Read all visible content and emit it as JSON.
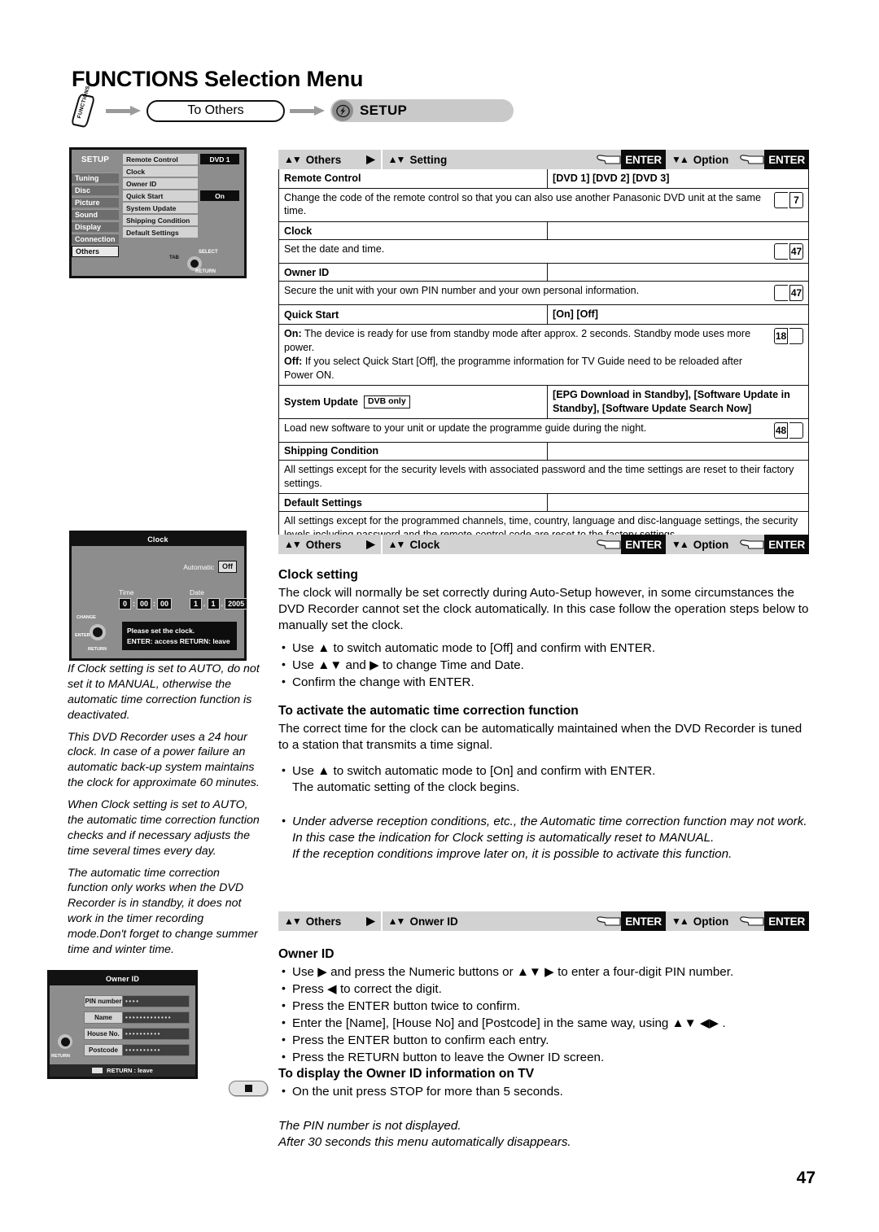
{
  "page": {
    "title": "FUNCTIONS Selection Menu",
    "folio": "47"
  },
  "flow": {
    "functions_button": "FUNCTIONS",
    "to_others": "To Others",
    "setup": "SETUP",
    "setup_icon": "lightning-bolt-icon"
  },
  "setup_screen": {
    "title": "SETUP",
    "categories": [
      "Tuning",
      "Disc",
      "Picture",
      "Sound",
      "Display",
      "Connection",
      "Others"
    ],
    "selected_category": "Others",
    "items": [
      {
        "name": "Remote Control",
        "value": "DVD 1"
      },
      {
        "name": "Clock",
        "value": ""
      },
      {
        "name": "Owner ID",
        "value": ""
      },
      {
        "name": "Quick Start",
        "value": "On"
      },
      {
        "name": "System Update",
        "value": ""
      },
      {
        "name": "Shipping Condition",
        "value": ""
      },
      {
        "name": "Default Settings",
        "value": ""
      }
    ],
    "hint_tab": "TAB",
    "hint_select": "SELECT",
    "hint_return": "RETURN"
  },
  "clock_screen": {
    "title": "Clock",
    "automatic_label": "Automatic",
    "automatic_value": "Off",
    "time_label": "Time",
    "date_label": "Date",
    "time_fields": [
      "0",
      "00",
      "00"
    ],
    "date_fields": [
      "1",
      "1",
      "2005"
    ],
    "message_line1": "Please set the clock.",
    "message_line2": "ENTER: access   RETURN: leave",
    "dpad_change": "CHANGE",
    "dpad_enter": "ENTER",
    "dpad_return": "RETURN"
  },
  "owner_screen": {
    "title": "Owner ID",
    "fields": [
      {
        "label": "PIN number",
        "value": "••••"
      },
      {
        "label": "Name",
        "value": "•••••••••••••"
      },
      {
        "label": "House No.",
        "value": "••••••••••"
      },
      {
        "label": "Postcode",
        "value": "••••••••••"
      }
    ],
    "dpad_return": "RETURN",
    "footer": "RETURN : leave"
  },
  "bar_setting": {
    "nav1_arrows": "▲▼",
    "nav1_label": "Others",
    "nav_right_arrow": "▶",
    "nav2_arrows": "▲▼",
    "nav2_label": "Setting",
    "enter1": "ENTER",
    "opt_arrows": "▼▲",
    "opt_label": "Option",
    "enter2": "ENTER"
  },
  "bar_clock": {
    "nav1_arrows": "▲▼",
    "nav1_label": "Others",
    "nav_right_arrow": "▶",
    "nav2_arrows": "▲▼",
    "nav2_label": "Clock",
    "enter1": "ENTER",
    "opt_arrows": "▼▲",
    "opt_label": "Option",
    "enter2": "ENTER"
  },
  "bar_owner": {
    "nav1_arrows": "▲▼",
    "nav1_label": "Others",
    "nav_right_arrow": "▶",
    "nav2_arrows": "▲▼",
    "nav2_label": "Onwer ID",
    "enter1": "ENTER",
    "opt_arrows": "▼▲",
    "opt_label": "Option",
    "enter2": "ENTER"
  },
  "spec_table": [
    {
      "name": "Remote Control",
      "options": "[DVD 1]  [DVD 2]  [DVD 3]",
      "desc": "Change the code of the remote control so that you can also use another Panasonic DVD unit at the same time.",
      "page_ref": "7",
      "page_ref_side": "right",
      "badge": ""
    },
    {
      "name": "Clock",
      "options": "",
      "desc": "Set the date and time.",
      "page_ref": "47",
      "page_ref_side": "right",
      "badge": ""
    },
    {
      "name": "Owner ID",
      "options": "",
      "desc": "Secure the unit with your own PIN number and your own personal information.",
      "page_ref": "47",
      "page_ref_side": "right",
      "badge": ""
    },
    {
      "name": "Quick Start",
      "options": "[On]  [Off]",
      "desc": "",
      "desc_rich": [
        {
          "bold": "On:",
          "text": " The device is ready for use from standby mode after approx. 2 seconds. Standby mode uses more power."
        },
        {
          "bold": "Off:",
          "text": " If you select Quick Start [Off], the programme information for TV Guide need to be reloaded after Power ON."
        }
      ],
      "page_ref": "18",
      "page_ref_side": "left",
      "badge": ""
    },
    {
      "name": "System Update",
      "badge": "DVB only",
      "options": "[EPG Download in Standby], [Software Update in Standby], [Software Update Search Now]",
      "desc": "Load new software to your unit or update the programme guide during the night.",
      "page_ref": "48",
      "page_ref_side": "left"
    },
    {
      "name": "Shipping Condition",
      "options": "",
      "desc": "All settings except for the security levels with associated password and the time settings are reset to their factory settings.",
      "page_ref": "",
      "page_ref_side": "",
      "badge": ""
    },
    {
      "name": "Default Settings",
      "options": "",
      "desc": "All settings except for the programmed channels, time, country, language and disc-language settings, the security levels including password and the remote-control code are reset to the factory settings.",
      "page_ref": "",
      "page_ref_side": "",
      "badge": ""
    }
  ],
  "clock_section": {
    "heading": "Clock setting",
    "intro": "The clock will normally be set correctly during Auto-Setup however, in some circumstances the DVD Recorder cannot set the clock automatically. In this case follow the operation steps below to manually set the clock.",
    "bullets": [
      "Use ▲ to switch automatic mode to [Off] and confirm with ENTER.",
      "Use ▲▼ and ▶ to change Time and Date.",
      "Confirm the change with ENTER."
    ],
    "sub_heading": "To activate the automatic time correction function",
    "sub_intro": "The correct time for the clock can be automatically maintained when the DVD Recorder is tuned to a station that transmits a time signal.",
    "bullet_on_1": "Use ▲ to switch automatic mode to [On] and confirm with ENTER.",
    "bullet_on_2": "The automatic setting of the clock begins.",
    "bullet_italic_1": "Under adverse reception conditions, etc., the Automatic time correction function may not work. In this case the indication for Clock setting is automatically reset to MANUAL.",
    "bullet_italic_2": "If the reception conditions improve later on, it is possible to activate this function."
  },
  "clock_notes": [
    "If Clock setting is set to AUTO, do not set it to MANUAL, otherwise the automatic time correction function is deactivated.",
    "This DVD Recorder uses a 24 hour clock. In case of a power failure an automatic back-up system maintains the clock for approximate 60 minutes.",
    "When Clock setting is set to AUTO, the automatic time correction function checks and if necessary adjusts the time several times every day.",
    "The automatic time correction function only works when the DVD Recorder is in standby, it does not work in the timer recording mode.Don't forget to change summer time and winter time."
  ],
  "owner_section": {
    "heading": "Owner ID",
    "bullets": [
      "Use ▶ and press the Numeric buttons or ▲▼ ▶ to enter a four-digit PIN number.",
      "Press ◀ to correct the digit.",
      "Press the ENTER button twice to confirm.",
      "Enter the [Name], [House No] and [Postcode] in the same way, using ▲▼ ◀▶ .",
      "Press the ENTER button to confirm each entry.",
      "Press the RETURN button to leave the Owner ID screen."
    ],
    "sub_heading": "To display the Owner ID information on TV",
    "sub_bullet": "On the unit press STOP for more than 5 seconds.",
    "note_1": "The PIN number is not displayed.",
    "note_2": "After 30 seconds this menu automatically disappears.",
    "stop_button_icon": "stop-button-icon"
  }
}
